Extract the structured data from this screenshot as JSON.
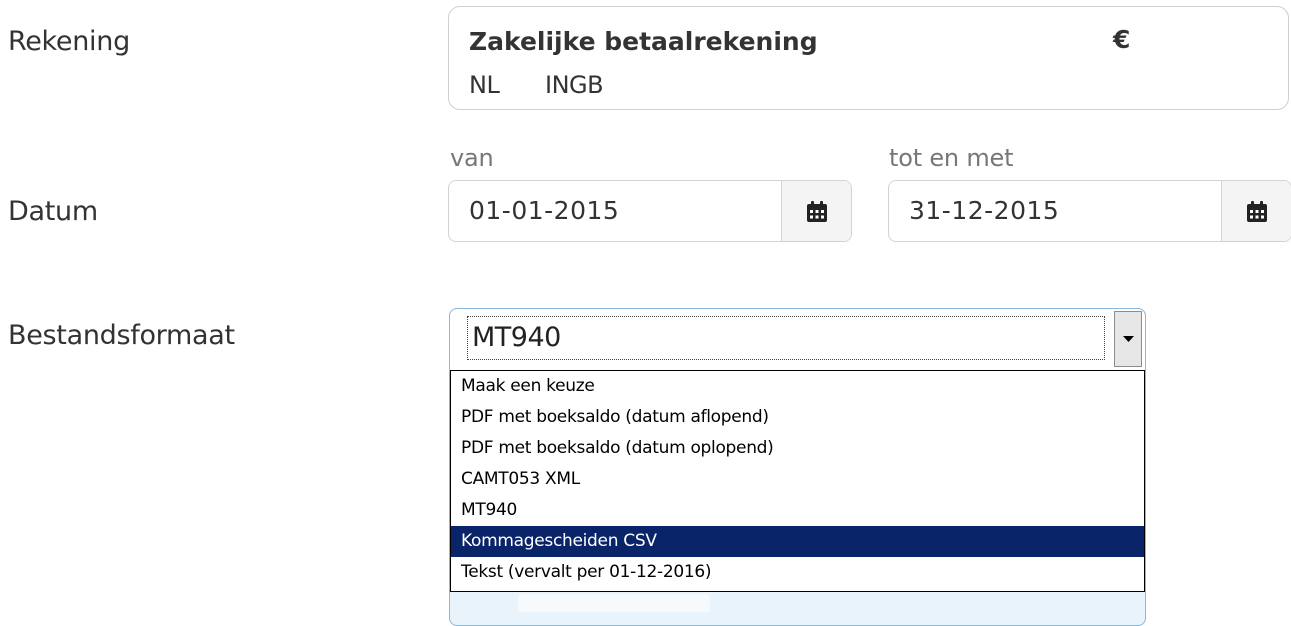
{
  "labels": {
    "rekening": "Rekening",
    "datum": "Datum",
    "bestandsformaat": "Bestandsformaat"
  },
  "account": {
    "name": "Zakelijke betaalrekening",
    "currency": "€",
    "country": "NL",
    "bank": "INGB"
  },
  "date_range": {
    "from_label": "van",
    "from_value": "01-01-2015",
    "to_label": "tot en met",
    "to_value": "31-12-2015",
    "icon": "calendar-icon"
  },
  "file_format": {
    "selected_value": "MT940",
    "options": [
      "Maak een keuze",
      "PDF met boeksaldo (datum aflopend)",
      "PDF met boeksaldo (datum oplopend)",
      "CAMT053 XML",
      "MT940",
      "Kommagescheiden CSV",
      "Tekst (vervalt per 01-12-2016)"
    ],
    "highlighted_index": 5
  },
  "colors": {
    "highlight": "#0a246a",
    "focus_border": "#88b8dc",
    "text": "#333333",
    "muted": "#777777"
  }
}
